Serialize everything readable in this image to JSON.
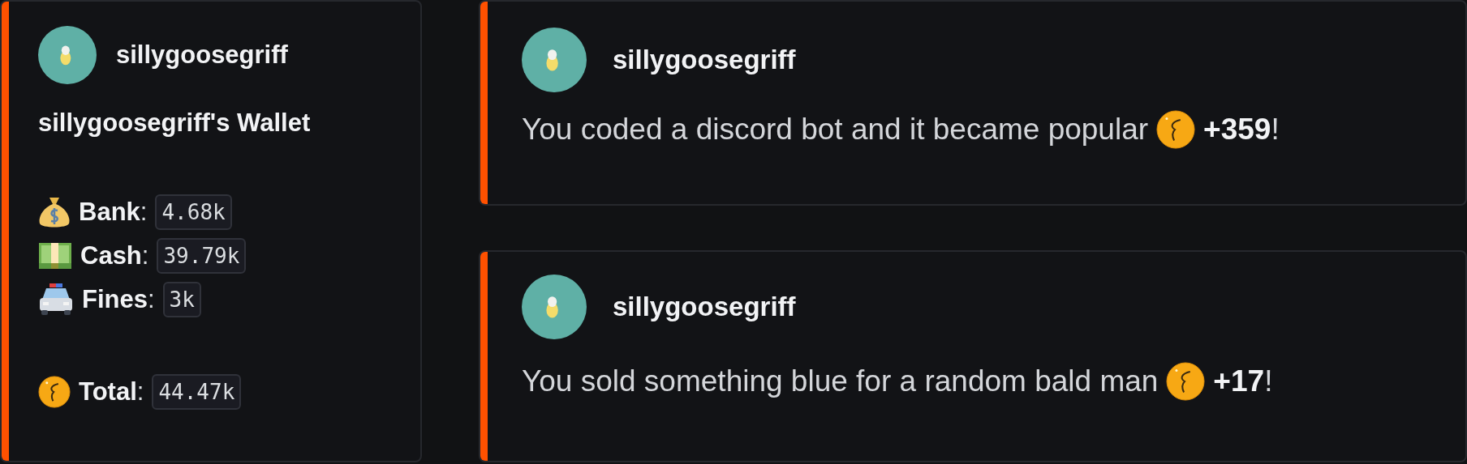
{
  "wallet_card": {
    "username": "sillygoosegriff",
    "title": "sillygoosegriff's Wallet",
    "balances": [
      {
        "kind": "bank",
        "label": "**Bank**:",
        "value": "4.68k"
      },
      {
        "kind": "cash",
        "label": "**Cash**:",
        "value": "39.79k"
      },
      {
        "kind": "fines",
        "label": "**Fines**:",
        "value": "3k"
      }
    ],
    "total": {
      "kind": "coin",
      "label": "**Total**:",
      "value": "44.47k"
    }
  },
  "work_messages": [
    {
      "username": "sillygoosegriff",
      "text": "You coded a discord bot and it became popular",
      "reward": "**+359**!"
    },
    {
      "username": "sillygoosegriff",
      "text": "You sold something blue for a random bald man",
      "reward": "**+17**!"
    }
  ]
}
